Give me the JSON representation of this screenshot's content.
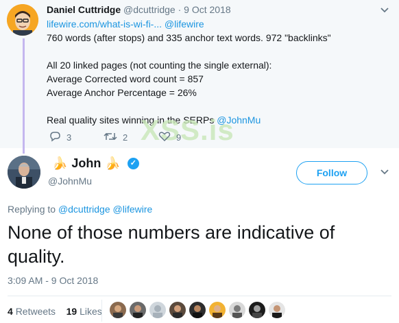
{
  "parent_tweet": {
    "author_name": "Daniel Cuttridge",
    "author_handle": "@dcuttridge",
    "date": "9 Oct 2018",
    "link_text": "lifewire.com/what-is-wi-fi-...",
    "mention": "@lifewire",
    "lines": [
      "760 words (after stops) and 335 anchor text words. 972 \"backlinks\"",
      "All 20 linked pages (not counting the single external):",
      "Average Corrected word count = 857",
      "Average Anchor Percentage = 26%",
      "Real quality sites winning in the SERPs",
      "@JohnMu"
    ],
    "replies": "3",
    "retweets": "2",
    "likes": "9"
  },
  "watermark": "XSS.is",
  "main_tweet": {
    "author_name": "John",
    "author_handle": "@JohnMu",
    "follow_label": "Follow",
    "replying_prefix": "Replying to",
    "replying_to_1": "@dcuttridge",
    "replying_to_2": "@lifewire",
    "text": "None of those numbers are indicative of quality.",
    "timestamp": "3:09 AM - 9 Oct 2018",
    "retweet_count": "4",
    "retweet_label": "Retweets",
    "like_count": "19",
    "like_label": "Likes"
  },
  "colors": {
    "accent": "#1da1f2",
    "thread_line": "#c4b7ef",
    "muted": "#657786",
    "link": "#1b95e0"
  },
  "icons": [
    "reply-icon",
    "retweet-icon",
    "heart-icon",
    "chevron-down-icon",
    "verified-badge-icon",
    "banana-emoji"
  ]
}
